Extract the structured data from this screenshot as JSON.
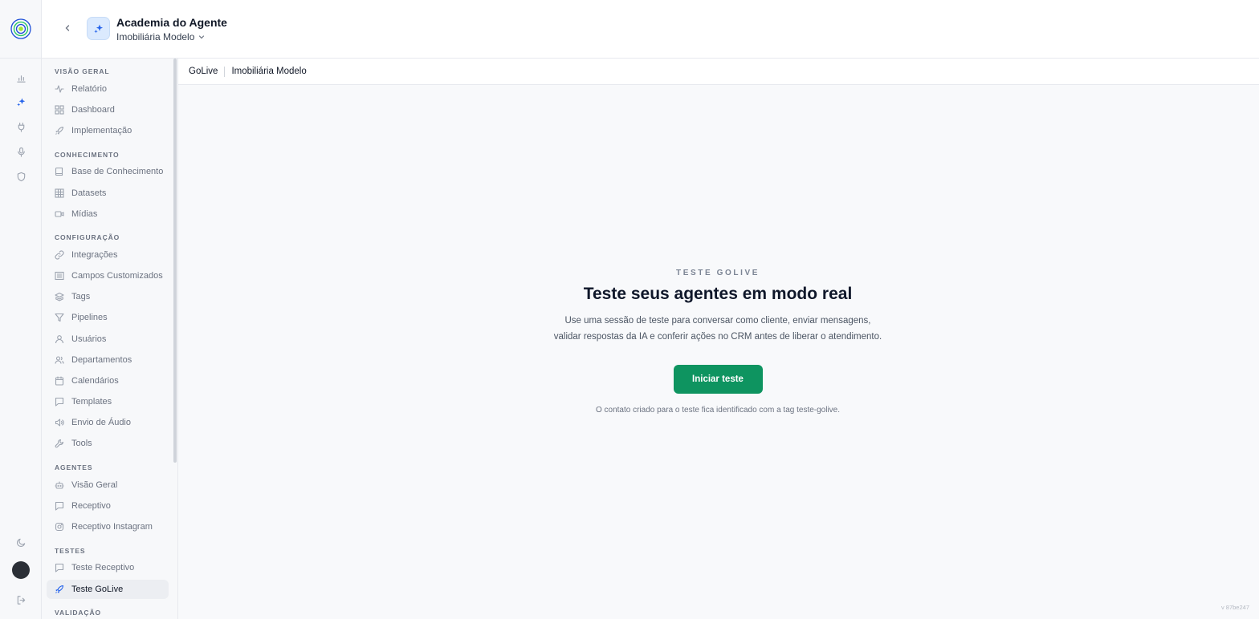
{
  "app": {
    "title": "Academia do Agente",
    "workspace": "Imobiliária Modelo",
    "version": "v 87be247"
  },
  "rail": {
    "items": [
      {
        "icon": "bar-chart-icon",
        "active": false
      },
      {
        "icon": "sparkles-icon",
        "active": true
      },
      {
        "icon": "plug-icon",
        "active": false
      },
      {
        "icon": "microphone-icon",
        "active": false
      },
      {
        "icon": "shield-icon",
        "active": false
      }
    ],
    "bottom": [
      "moon-icon",
      "avatar",
      "logout-icon"
    ]
  },
  "sidebar": {
    "sections": [
      {
        "title": "VISÃO GERAL",
        "items": [
          {
            "label": "Relatório",
            "icon": "activity-icon"
          },
          {
            "label": "Dashboard",
            "icon": "grid-icon"
          },
          {
            "label": "Implementação",
            "icon": "rocket-icon"
          }
        ]
      },
      {
        "title": "CONHECIMENTO",
        "items": [
          {
            "label": "Base de Conhecimento",
            "icon": "book-icon"
          },
          {
            "label": "Datasets",
            "icon": "table-icon"
          },
          {
            "label": "Mídias",
            "icon": "video-icon"
          }
        ]
      },
      {
        "title": "CONFIGURAÇÃO",
        "items": [
          {
            "label": "Integrações",
            "icon": "link-icon"
          },
          {
            "label": "Campos Customizados",
            "icon": "list-icon"
          },
          {
            "label": "Tags",
            "icon": "layers-icon"
          },
          {
            "label": "Pipelines",
            "icon": "filter-icon"
          },
          {
            "label": "Usuários",
            "icon": "user-icon"
          },
          {
            "label": "Departamentos",
            "icon": "users-icon"
          },
          {
            "label": "Calendários",
            "icon": "calendar-icon"
          },
          {
            "label": "Templates",
            "icon": "message-icon"
          },
          {
            "label": "Envio de Áudio",
            "icon": "speaker-icon"
          },
          {
            "label": "Tools",
            "icon": "wrench-icon"
          }
        ]
      },
      {
        "title": "AGENTES",
        "items": [
          {
            "label": "Visão Geral",
            "icon": "bot-icon"
          },
          {
            "label": "Receptivo",
            "icon": "message-icon"
          },
          {
            "label": "Receptivo Instagram",
            "icon": "instagram-icon"
          }
        ]
      },
      {
        "title": "TESTES",
        "items": [
          {
            "label": "Teste Receptivo",
            "icon": "message-icon"
          },
          {
            "label": "Teste GoLive",
            "icon": "rocket-icon",
            "active": true
          }
        ]
      },
      {
        "title": "VALIDAÇÃO",
        "items": []
      }
    ]
  },
  "breadcrumb": [
    "GoLive",
    "Imobiliária Modelo"
  ],
  "main": {
    "eyebrow": "TESTE GOLIVE",
    "heading": "Teste seus agentes em modo real",
    "description": "Use uma sessão de teste para conversar como cliente, enviar mensagens, validar respostas da IA e conferir ações no CRM antes de liberar o atendimento.",
    "cta_label": "Iniciar teste",
    "note": "O contato criado para o teste fica identificado com a tag teste-golive."
  },
  "colors": {
    "accent_green": "#0e9460",
    "active_icon_blue": "#2563eb",
    "logo_ring": "#1d4ed8",
    "logo_dot": "#a3e635"
  }
}
